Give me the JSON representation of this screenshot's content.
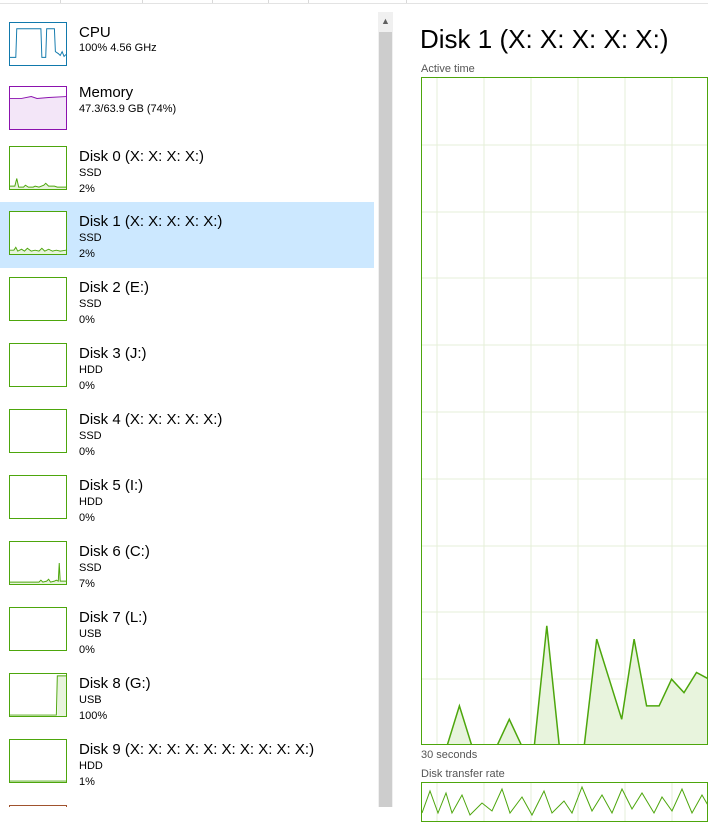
{
  "colors": {
    "disk_line": "#4da60c",
    "cpu_line": "#1179ac",
    "memory_line": "#8b12ae",
    "selected_bg": "#cce8ff",
    "grid": "#e6efd9"
  },
  "sidebar": {
    "items": [
      {
        "name": "CPU",
        "sub1": "100% 4.56 GHz",
        "sub2": ""
      },
      {
        "name": "Memory",
        "sub1": "47.3/63.9 GB (74%)",
        "sub2": ""
      },
      {
        "name": "Disk 0 (X: X: X: X:)",
        "sub1": "SSD",
        "sub2": "2%"
      },
      {
        "name": "Disk 1 (X: X: X: X: X:)",
        "sub1": "SSD",
        "sub2": "2%",
        "selected": true
      },
      {
        "name": "Disk 2 (E:)",
        "sub1": "SSD",
        "sub2": "0%"
      },
      {
        "name": "Disk 3 (J:)",
        "sub1": "HDD",
        "sub2": "0%"
      },
      {
        "name": "Disk 4 (X: X: X: X: X:)",
        "sub1": "SSD",
        "sub2": "0%"
      },
      {
        "name": "Disk 5 (I:)",
        "sub1": "HDD",
        "sub2": "0%"
      },
      {
        "name": "Disk 6 (C:)",
        "sub1": "SSD",
        "sub2": "7%"
      },
      {
        "name": "Disk 7 (L:)",
        "sub1": "USB",
        "sub2": "0%"
      },
      {
        "name": "Disk 8 (G:)",
        "sub1": "USB",
        "sub2": "100%"
      },
      {
        "name": "Disk 9 (X: X: X: X: X: X: X: X: X: X:)",
        "sub1": "HDD",
        "sub2": "1%"
      }
    ]
  },
  "detail": {
    "title": "Disk 1 (X: X: X: X: X:)",
    "active_time_label": "Active time",
    "time_span_label": "30 seconds",
    "transfer_rate_label": "Disk transfer rate",
    "active_time_series": [
      0,
      0,
      0,
      6,
      0,
      0,
      0,
      4,
      0,
      0,
      18,
      0,
      0,
      0,
      16,
      10,
      4,
      16,
      6,
      6,
      10,
      8,
      11,
      10
    ]
  }
}
